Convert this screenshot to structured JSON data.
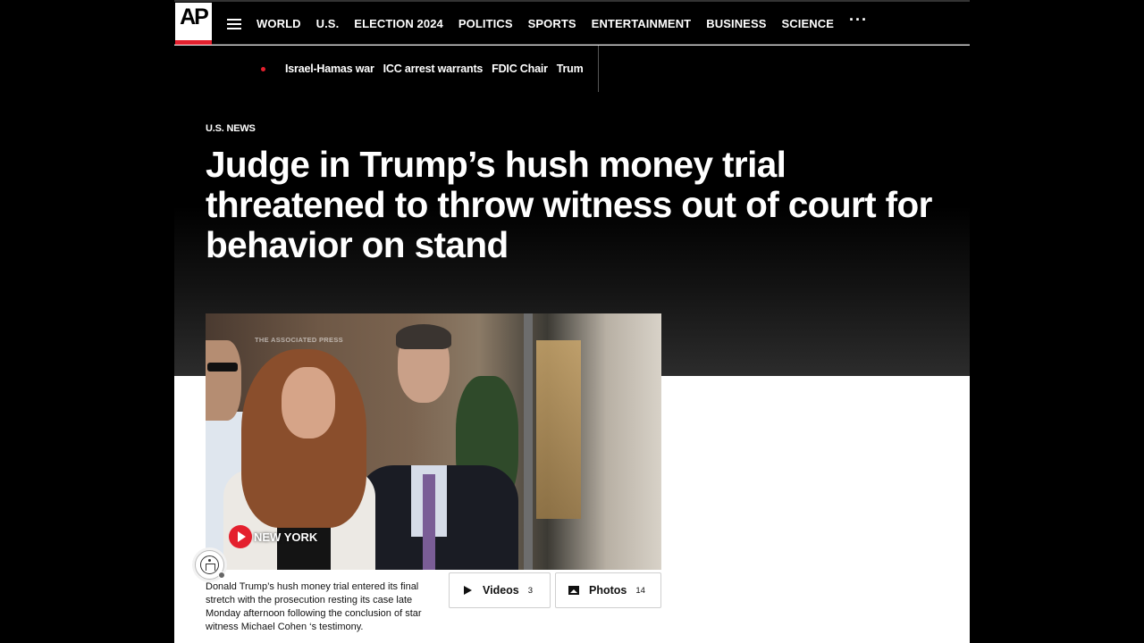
{
  "header": {
    "logo_text": "AP",
    "menu_icon": "hamburger-menu-icon",
    "nav": [
      "WORLD",
      "U.S.",
      "ELECTION 2024",
      "POLITICS",
      "SPORTS",
      "ENTERTAINMENT",
      "BUSINESS",
      "SCIENCE"
    ],
    "more_icon": "more-dots-icon",
    "accent_color": "#e4202e"
  },
  "trending": {
    "items": [
      "Israel-Hamas war",
      "ICC arrest warrants",
      "FDIC Chair",
      "Trum"
    ]
  },
  "article": {
    "section": "U.S. NEWS",
    "headline": "Judge in Trump’s hush money trial threatened to throw witness out of court for behavior on stand"
  },
  "media": {
    "watermark": "THE ASSOCIATED PRESS",
    "location": "NEW YORK",
    "caption": "Donald Trump’s hush money trial entered its final stretch with the prosecution resting its case late Monday afternoon following the conclusion of star witness Michael Cohen ‘s testimony.",
    "videos_label": "Videos",
    "videos_count": "3",
    "photos_label": "Photos",
    "photos_count": "14"
  }
}
